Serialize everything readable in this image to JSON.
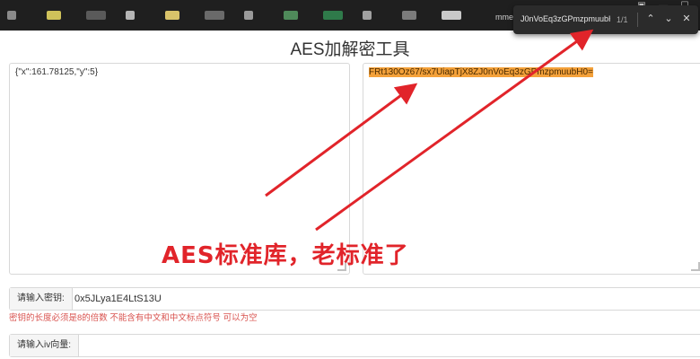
{
  "browser": {
    "tab_text": "mme",
    "tab_chip_colors": [
      "#8a8a8a",
      "#cfc25a",
      "#5a5a5a",
      "#b5b5b5",
      "#d9c36a",
      "#6a6a6a",
      "#9a9a9a",
      "#4f8a5a",
      "#2f7a4a",
      "#a0a0a0",
      "#7b7b7b",
      "#c9c9c9"
    ],
    "find": {
      "query": "J0nVoEq3zGPmzpmuubH0=",
      "count": "1/1",
      "prev_icon": "chevron-up-icon",
      "next_icon": "chevron-down-icon",
      "close_icon": "close-icon"
    }
  },
  "page": {
    "title": "AES加解密工具",
    "plaintext": "{\"x\":161.78125,\"y\":5}",
    "ciphertext": "FRt130Oz67/sx7UiapTjX8ZJ0nVoEq3zGPmzpmuubH0=",
    "key": {
      "label": "请输入密钥:",
      "value": "0x5JLya1E4LtS13U",
      "hint": "密钥的长度必须是8的倍数 不能含有中文和中文标点符号 可以为空"
    },
    "iv": {
      "label": "请输入iv向量:",
      "value": ""
    }
  },
  "annotation": {
    "text": "AES标准库，老标准了",
    "color": "#e1242a"
  }
}
